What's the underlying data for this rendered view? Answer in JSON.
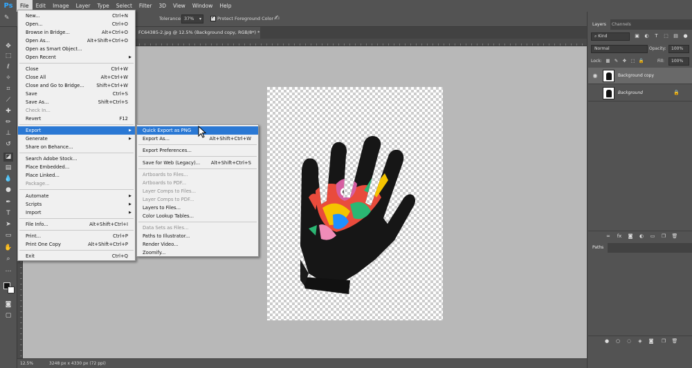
{
  "app": {
    "logo": "Ps"
  },
  "menubar": [
    "File",
    "Edit",
    "Image",
    "Layer",
    "Type",
    "Select",
    "Filter",
    "3D",
    "View",
    "Window",
    "Help"
  ],
  "options_bar": {
    "tolerance_label": "Tolerance:",
    "tolerance_value": "37%",
    "protect_label": "Protect Foreground Color"
  },
  "document": {
    "tab_title": "FC64385-2.jpg @ 12.5% (Background copy, RGB/8*) *",
    "zoom": "12.5%",
    "info": "3248 px x 4330 px (72 ppi)"
  },
  "file_menu": {
    "items": [
      {
        "label": "New...",
        "shortcut": "Ctrl+N"
      },
      {
        "label": "Open...",
        "shortcut": "Ctrl+O"
      },
      {
        "label": "Browse in Bridge...",
        "shortcut": "Alt+Ctrl+O"
      },
      {
        "label": "Open As...",
        "shortcut": "Alt+Shift+Ctrl+O"
      },
      {
        "label": "Open as Smart Object..."
      },
      {
        "label": "Open Recent"
      },
      {
        "label": "Close",
        "shortcut": "Ctrl+W"
      },
      {
        "label": "Close All",
        "shortcut": "Alt+Ctrl+W"
      },
      {
        "label": "Close and Go to Bridge...",
        "shortcut": "Shift+Ctrl+W"
      },
      {
        "label": "Save",
        "shortcut": "Ctrl+S"
      },
      {
        "label": "Save As...",
        "shortcut": "Shift+Ctrl+S"
      },
      {
        "label": "Check In..."
      },
      {
        "label": "Revert",
        "shortcut": "F12"
      },
      {
        "label": "Export"
      },
      {
        "label": "Generate"
      },
      {
        "label": "Share on Behance..."
      },
      {
        "label": "Search Adobe Stock..."
      },
      {
        "label": "Place Embedded..."
      },
      {
        "label": "Place Linked..."
      },
      {
        "label": "Package..."
      },
      {
        "label": "Automate"
      },
      {
        "label": "Scripts"
      },
      {
        "label": "Import"
      },
      {
        "label": "File Info...",
        "shortcut": "Alt+Shift+Ctrl+I"
      },
      {
        "label": "Print...",
        "shortcut": "Ctrl+P"
      },
      {
        "label": "Print One Copy",
        "shortcut": "Alt+Shift+Ctrl+P"
      },
      {
        "label": "Exit",
        "shortcut": "Ctrl+Q"
      }
    ]
  },
  "export_menu": {
    "items": [
      {
        "label": "Quick Export as PNG"
      },
      {
        "label": "Export As...",
        "shortcut": "Alt+Shift+Ctrl+W"
      },
      {
        "label": "Export Preferences..."
      },
      {
        "label": "Save for Web (Legacy)...",
        "shortcut": "Alt+Shift+Ctrl+S"
      },
      {
        "label": "Artboards to Files..."
      },
      {
        "label": "Artboards to PDF..."
      },
      {
        "label": "Layer Comps to Files..."
      },
      {
        "label": "Layer Comps to PDF..."
      },
      {
        "label": "Layers to Files..."
      },
      {
        "label": "Color Lookup Tables..."
      },
      {
        "label": "Data Sets as Files..."
      },
      {
        "label": "Paths to Illustrator..."
      },
      {
        "label": "Render Video..."
      },
      {
        "label": "Zoomify..."
      }
    ]
  },
  "layers_panel": {
    "tabs": [
      "Layers",
      "Channels"
    ],
    "kind_filter": "Kind",
    "blend_mode": "Normal",
    "opacity_label": "Opacity:",
    "opacity_value": "100%",
    "lock_label": "Lock:",
    "fill_label": "Fill:",
    "fill_value": "100%",
    "layers": [
      {
        "name": "Background copy",
        "selected": true
      },
      {
        "name": "Background",
        "selected": false
      }
    ]
  },
  "paths_panel": {
    "tab": "Paths"
  }
}
